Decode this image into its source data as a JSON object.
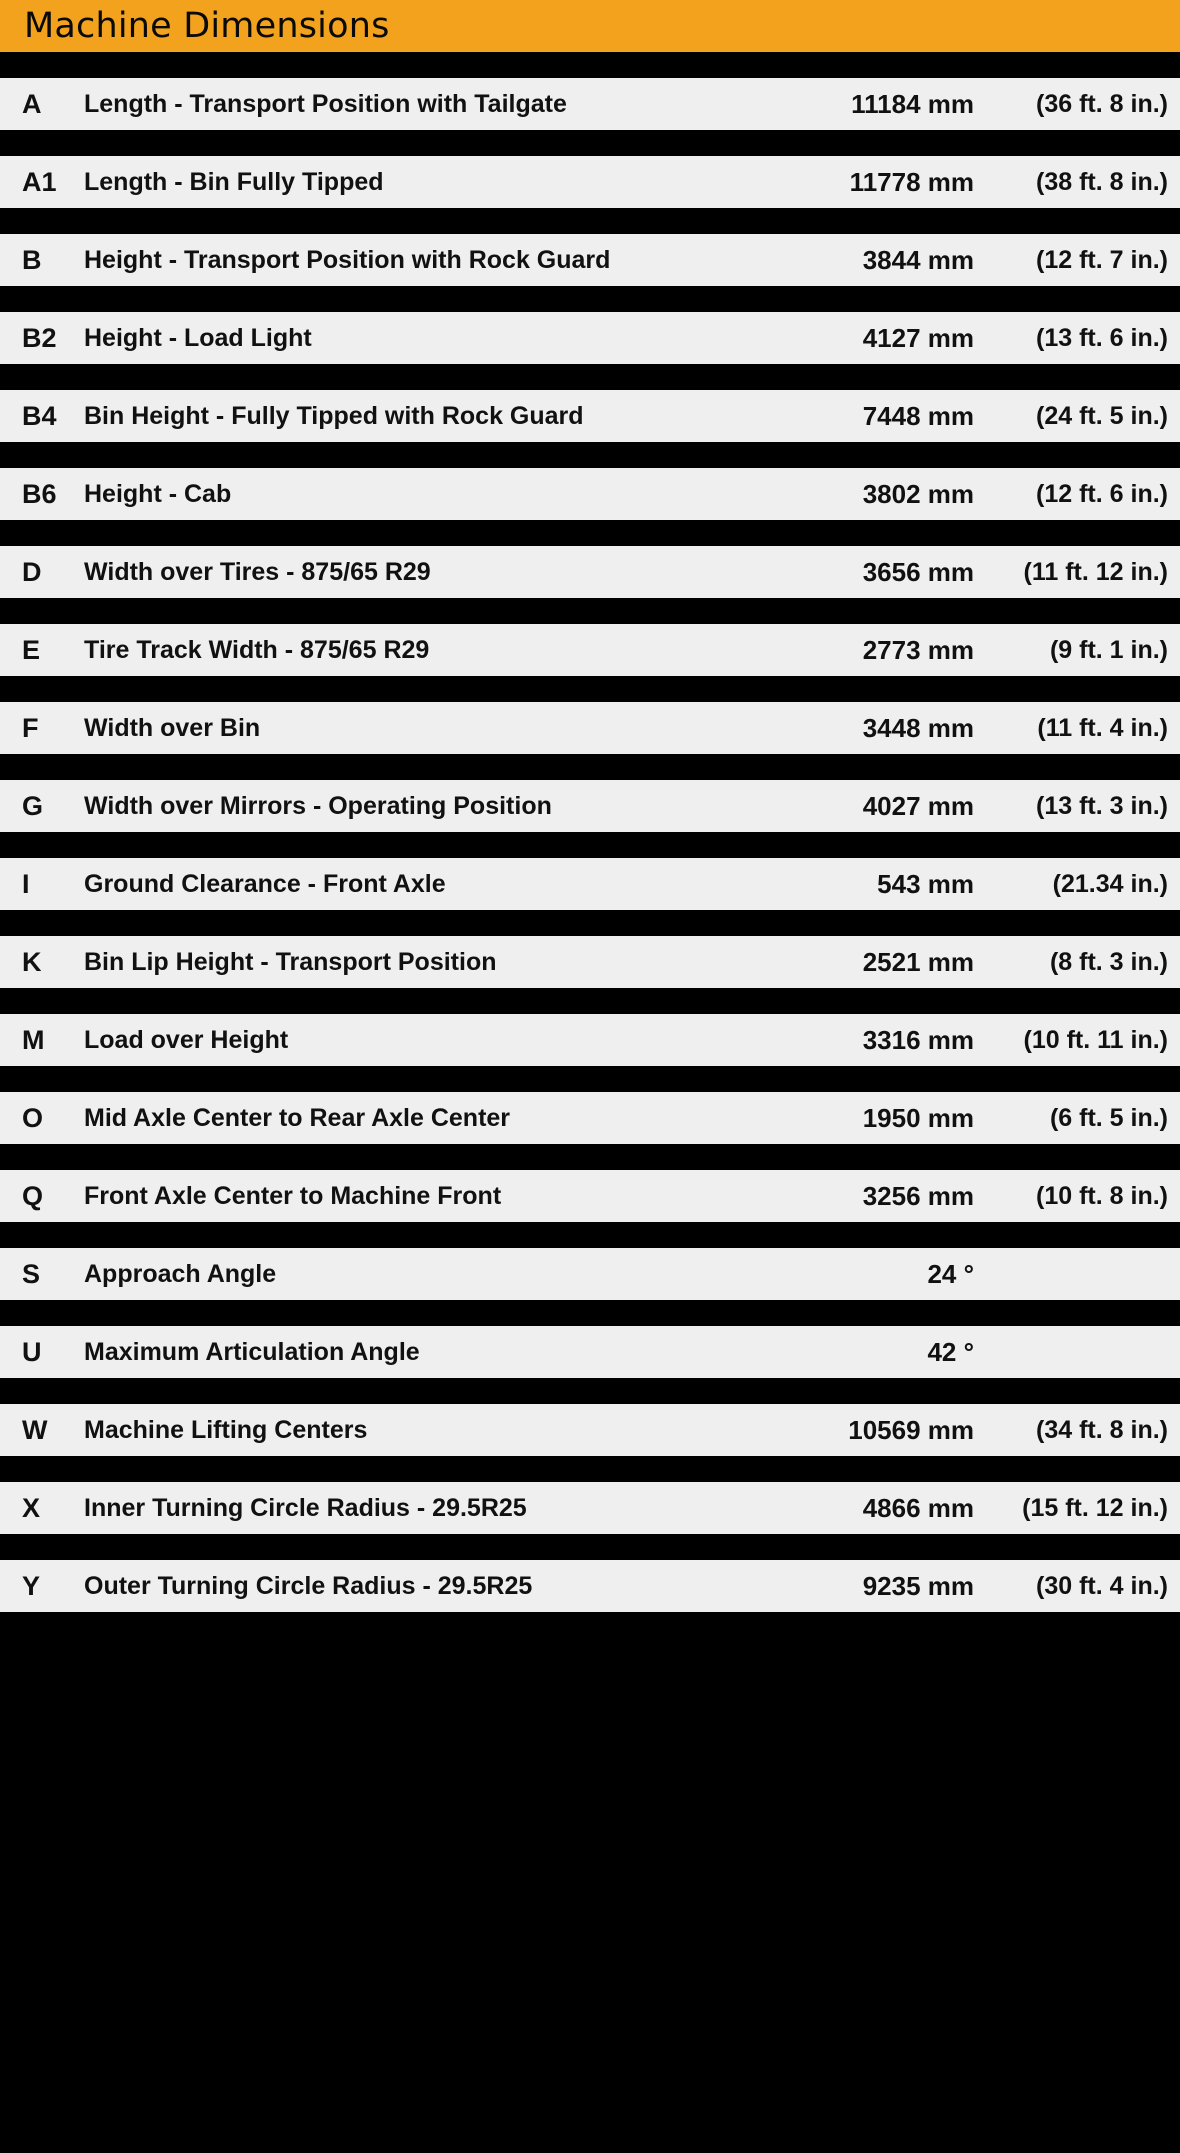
{
  "header": {
    "title": "Machine Dimensions",
    "background_color": "#F2A21C",
    "text_color": "#0A0A0A"
  },
  "theme": {
    "row_background": "#EFEFEF",
    "gap_background": "#000000",
    "text_color": "#111111",
    "accent_color": "#F2A21C"
  },
  "table": {
    "columns": [
      "code",
      "description",
      "metric",
      "imperial"
    ],
    "rows": [
      {
        "code": "A",
        "description": "Length - Transport Position with Tailgate",
        "metric": "11184 mm",
        "imperial": "(36 ft. 8 in.)"
      },
      {
        "code": "A1",
        "description": "Length - Bin Fully Tipped",
        "metric": "11778 mm",
        "imperial": "(38 ft. 8 in.)"
      },
      {
        "code": "B",
        "description": "Height - Transport Position with Rock Guard",
        "metric": "3844 mm",
        "imperial": "(12 ft. 7 in.)"
      },
      {
        "code": "B2",
        "description": "Height - Load Light",
        "metric": "4127 mm",
        "imperial": "(13 ft. 6 in.)"
      },
      {
        "code": "B4",
        "description": "Bin Height - Fully Tipped with Rock Guard",
        "metric": "7448 mm",
        "imperial": "(24 ft. 5 in.)"
      },
      {
        "code": "B6",
        "description": "Height - Cab",
        "metric": "3802 mm",
        "imperial": "(12 ft. 6 in.)"
      },
      {
        "code": "D",
        "description": "Width over Tires - 875/65 R29",
        "metric": "3656 mm",
        "imperial": "(11 ft. 12 in.)"
      },
      {
        "code": "E",
        "description": "Tire Track Width - 875/65 R29",
        "metric": "2773 mm",
        "imperial": "(9 ft. 1 in.)"
      },
      {
        "code": "F",
        "description": "Width over Bin",
        "metric": "3448 mm",
        "imperial": "(11 ft. 4 in.)"
      },
      {
        "code": "G",
        "description": "Width over Mirrors - Operating Position",
        "metric": "4027 mm",
        "imperial": "(13 ft. 3 in.)"
      },
      {
        "code": "I",
        "description": "Ground Clearance - Front Axle",
        "metric": "543 mm",
        "imperial": "(21.34 in.)"
      },
      {
        "code": "K",
        "description": "Bin Lip Height - Transport Position",
        "metric": "2521 mm",
        "imperial": "(8 ft. 3 in.)"
      },
      {
        "code": "M",
        "description": "Load over Height",
        "metric": "3316 mm",
        "imperial": "(10 ft. 11 in.)"
      },
      {
        "code": "O",
        "description": "Mid Axle Center to Rear Axle Center",
        "metric": "1950 mm",
        "imperial": "(6 ft. 5 in.)"
      },
      {
        "code": "Q",
        "description": "Front Axle Center to Machine Front",
        "metric": "3256 mm",
        "imperial": "(10 ft. 8 in.)"
      },
      {
        "code": "S",
        "description": "Approach Angle",
        "metric": "24 °",
        "imperial": ""
      },
      {
        "code": "U",
        "description": "Maximum Articulation Angle",
        "metric": "42 °",
        "imperial": ""
      },
      {
        "code": "W",
        "description": "Machine Lifting Centers",
        "metric": "10569 mm",
        "imperial": "(34 ft. 8 in.)"
      },
      {
        "code": "X",
        "description": "Inner Turning Circle Radius - 29.5R25",
        "metric": "4866 mm",
        "imperial": "(15 ft. 12 in.)"
      },
      {
        "code": "Y",
        "description": "Outer Turning Circle Radius - 29.5R25",
        "metric": "9235 mm",
        "imperial": "(30 ft. 4 in.)"
      }
    ]
  }
}
